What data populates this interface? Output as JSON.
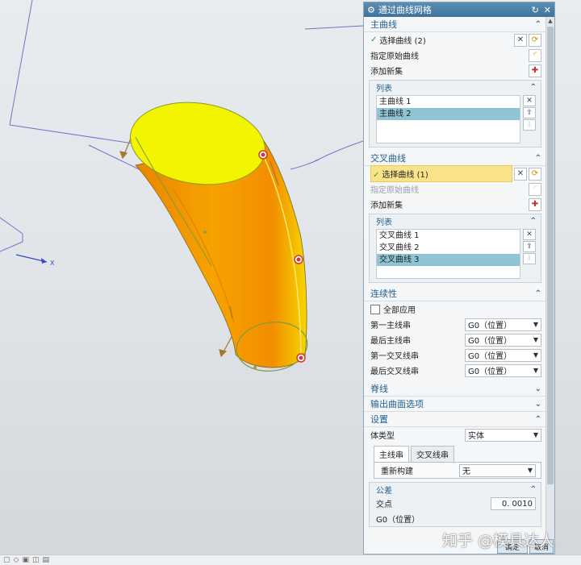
{
  "dialog": {
    "title": "通过曲线网格",
    "primary_curves": {
      "header": "主曲线",
      "select_label": "选择曲线 (2)",
      "specify_origin_label": "指定原始曲线",
      "add_new_set_label": "添加新集",
      "list_title": "列表",
      "items": [
        "主曲线 1",
        "主曲线 2"
      ],
      "selected_index": 1
    },
    "cross_curves": {
      "header": "交叉曲线",
      "select_label": "选择曲线 (1)",
      "specify_origin_label": "指定原始曲线",
      "add_new_set_label": "添加新集",
      "list_title": "列表",
      "items": [
        "交叉曲线 1",
        "交叉曲线 2",
        "交叉曲线 3"
      ],
      "selected_index": 2
    },
    "continuity": {
      "header": "连续性",
      "apply_all_label": "全部应用",
      "rows": [
        {
          "label": "第一主线串",
          "value": "G0（位置）"
        },
        {
          "label": "最后主线串",
          "value": "G0（位置）"
        },
        {
          "label": "第一交叉线串",
          "value": "G0（位置）"
        },
        {
          "label": "最后交叉线串",
          "value": "G0（位置）"
        }
      ]
    },
    "spine": {
      "header": "脊线"
    },
    "output_options": {
      "header": "输出曲面选项"
    },
    "settings": {
      "header": "设置",
      "body_type_label": "体类型",
      "body_type_value": "实体",
      "tabs": [
        "主线串",
        "交叉线串"
      ],
      "rebuild_label": "重新构建",
      "rebuild_value": "无",
      "tolerance_title": "公差",
      "intersection_label": "交点",
      "intersection_value": "0. 0010",
      "g0_label": "G0（位置）"
    },
    "footer": {
      "ok": "确定",
      "cancel": "取消"
    }
  },
  "viewport": {
    "axis_label": "X",
    "colors": {
      "cap": "#f3f500",
      "tube": "#f39a00",
      "handle": "#d23a2a"
    }
  },
  "watermark": "知乎 @模具达人",
  "icons": [
    "gear-icon",
    "reset-icon",
    "close-icon",
    "chevron-up-icon",
    "chevron-down-icon",
    "curve-select-icon",
    "cross-icon",
    "up-arrow-icon",
    "down-arrow-icon",
    "add-set-icon",
    "origin-curve-icon"
  ]
}
